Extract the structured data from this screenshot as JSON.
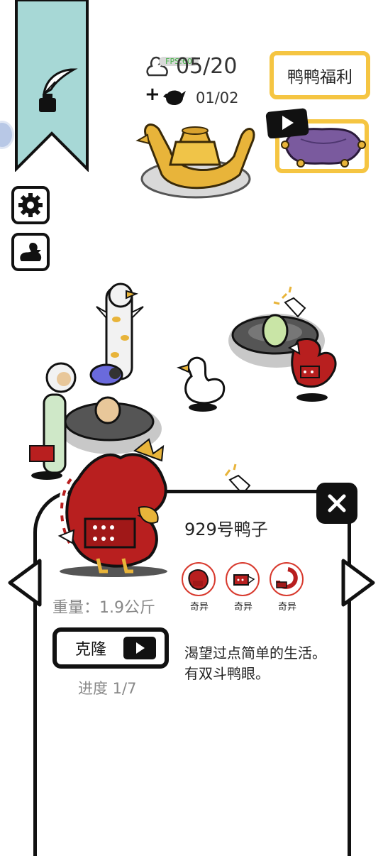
{
  "header": {
    "duck_count": "05/20",
    "fps_label": "FPS:60",
    "pot_plus": "+",
    "pot_count": "01/02",
    "welfare_label": "鸭鸭福利"
  },
  "panel": {
    "duck_name": "929号鸭子",
    "traits": [
      {
        "label": "奇异",
        "icon": "dragon-duck-icon"
      },
      {
        "label": "奇异",
        "icon": "dragon-segment-icon"
      },
      {
        "label": "奇异",
        "icon": "dragon-coil-icon"
      }
    ],
    "weight": "重量：1.9公斤",
    "clone_label": "克隆",
    "progress": "进度 1/7",
    "description": "渴望过点简单的生活。 有双斗鸭眼。"
  },
  "colors": {
    "ribbon": "#a7d8d6",
    "gold": "#f5c542",
    "dragon_red": "#b81f1f",
    "trait_ring": "#d83a2e",
    "cushion": "#7a5a9e",
    "egg": "#c9e5a6"
  }
}
